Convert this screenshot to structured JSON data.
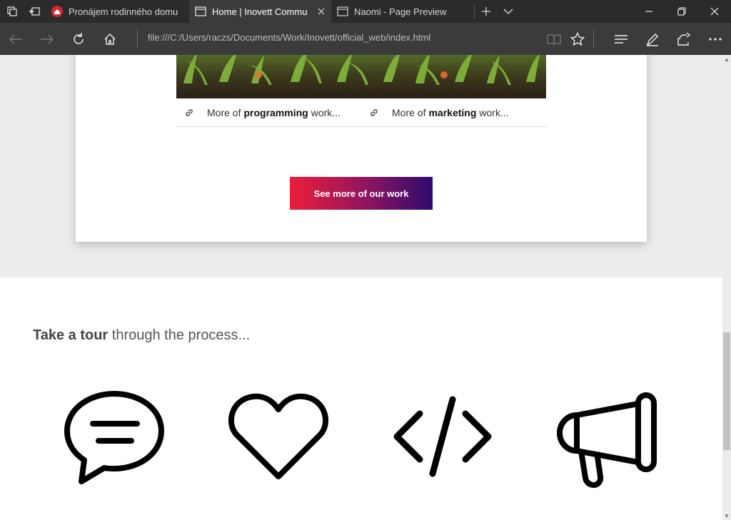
{
  "browser": {
    "tabs": [
      {
        "title": "Pronájem rodinného domu",
        "icon": "pin-favicon-icon",
        "active": false
      },
      {
        "title": "Home | Inovett Commu",
        "icon": "page-icon",
        "active": true
      },
      {
        "title": "Naomi - Page Preview",
        "icon": "page-icon",
        "active": false
      }
    ],
    "address": "file:///C:/Users/raczs/Documents/Work/Inovett/official_web/index.html"
  },
  "page": {
    "links": {
      "programming": {
        "prefix": "More of",
        "bold": "programming",
        "suffix": "work..."
      },
      "marketing": {
        "prefix": "More of",
        "bold": "marketing",
        "suffix": "work..."
      }
    },
    "cta_label": "See more of our work",
    "process": {
      "title_bold": "Take a tour",
      "title_rest": "through the process...",
      "steps": [
        "speech-bubble-icon",
        "heart-icon",
        "code-icon",
        "megaphone-icon"
      ]
    }
  },
  "colors": {
    "cta_start": "#ee1d3a",
    "cta_end": "#2b0a6e",
    "chrome_dark": "#2b2b2b",
    "chrome_toolbar": "#3b3b3b"
  }
}
